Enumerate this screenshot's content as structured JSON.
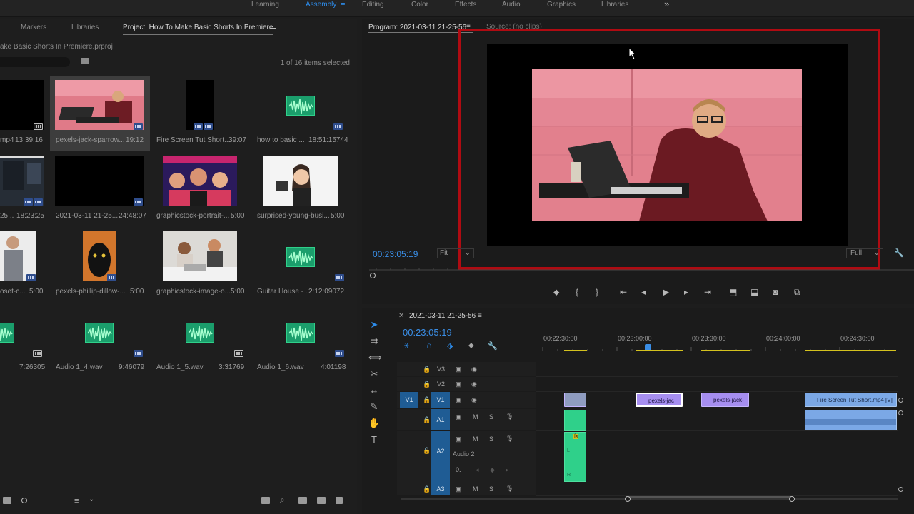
{
  "workspaces": {
    "tabs": [
      "Learning",
      "Assembly",
      "Editing",
      "Color",
      "Effects",
      "Audio",
      "Graphics",
      "Libraries"
    ],
    "active": "Assembly",
    "more": "»"
  },
  "project": {
    "tabs": [
      "Markers",
      "Libraries",
      "Project: How To Make Basic Shorts In Premiere"
    ],
    "path": "ake Basic Shorts In Premiere.prproj",
    "items_count": "1 of 16 items selected",
    "items": [
      {
        "name": "mp4",
        "dur": "13:39:16"
      },
      {
        "name": "pexels-jack-sparrow...",
        "dur": "19:12"
      },
      {
        "name": "Fire Screen Tut Short...",
        "dur": "39:07"
      },
      {
        "name": "how to basic ...",
        "dur": "18:51:15744"
      },
      {
        "name": "25...",
        "dur": "18:23:25"
      },
      {
        "name": "2021-03-11 21-25...",
        "dur": "24:48:07"
      },
      {
        "name": "graphicstock-portrait-...",
        "dur": "5:00"
      },
      {
        "name": "surprised-young-busi...",
        "dur": "5:00"
      },
      {
        "name": "oset-c...",
        "dur": "5:00"
      },
      {
        "name": "pexels-phillip-dillow-...",
        "dur": "5:00"
      },
      {
        "name": "graphicstock-image-o...",
        "dur": "5:00"
      },
      {
        "name": "Guitar House - ...",
        "dur": "2:12:09072"
      },
      {
        "name": "",
        "dur": "7:26305"
      },
      {
        "name": "Audio 1_4.wav",
        "dur": "9:46079"
      },
      {
        "name": "Audio 1_5.wav",
        "dur": "3:31769"
      },
      {
        "name": "Audio 1_6.wav",
        "dur": "4:01198"
      }
    ]
  },
  "program": {
    "tab": "Program: 2021-03-11 21-25-56",
    "source_tab": "Source: (no clips)",
    "timecode": "00:23:05:19",
    "fit": "Fit",
    "full": "Full"
  },
  "timeline": {
    "sequence": "2021-03-11 21-25-56",
    "timecode": "00:23:05:19",
    "ruler": [
      "00:22:30:00",
      "00:23:00:00",
      "00:23:30:00",
      "00:24:00:00",
      "00:24:30:00"
    ],
    "tracks": {
      "v3": "V3",
      "v2": "V2",
      "v1": "V1",
      "v1_src": "V1",
      "a1": "A1",
      "a2": "A2",
      "a3": "A3",
      "a2_name": "Audio 2"
    },
    "mute": "M",
    "solo": "S",
    "clips": {
      "c1": "pexels-jac",
      "c2": "pexels-jack-",
      "c3": "Fire Screen Tut Short.mp4 [V]"
    },
    "fx_badge": "fx",
    "l_label": "L",
    "r_label": "R"
  },
  "colors": {
    "accent": "#2d8ceb",
    "highlight_box": "#b00b12",
    "video_clip": "#a68ef0",
    "audio_clip": "#2fd08a"
  }
}
